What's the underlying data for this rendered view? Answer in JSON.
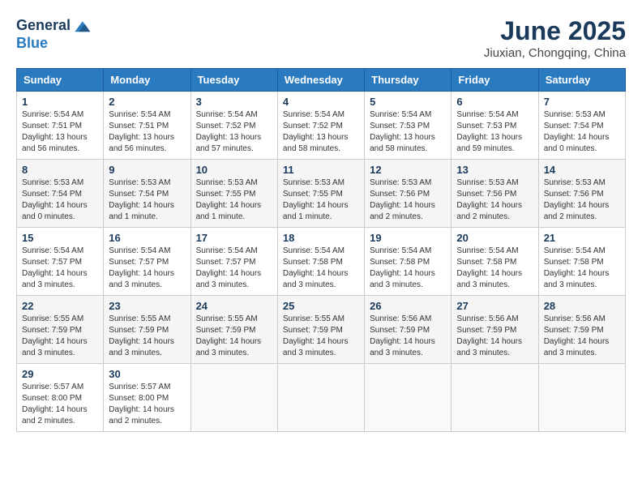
{
  "header": {
    "logo_line1": "General",
    "logo_line2": "Blue",
    "title": "June 2025",
    "subtitle": "Jiuxian, Chongqing, China"
  },
  "weekdays": [
    "Sunday",
    "Monday",
    "Tuesday",
    "Wednesday",
    "Thursday",
    "Friday",
    "Saturday"
  ],
  "weeks": [
    [
      {
        "day": "1",
        "lines": [
          "Sunrise: 5:54 AM",
          "Sunset: 7:51 PM",
          "Daylight: 13 hours",
          "and 56 minutes."
        ]
      },
      {
        "day": "2",
        "lines": [
          "Sunrise: 5:54 AM",
          "Sunset: 7:51 PM",
          "Daylight: 13 hours",
          "and 56 minutes."
        ]
      },
      {
        "day": "3",
        "lines": [
          "Sunrise: 5:54 AM",
          "Sunset: 7:52 PM",
          "Daylight: 13 hours",
          "and 57 minutes."
        ]
      },
      {
        "day": "4",
        "lines": [
          "Sunrise: 5:54 AM",
          "Sunset: 7:52 PM",
          "Daylight: 13 hours",
          "and 58 minutes."
        ]
      },
      {
        "day": "5",
        "lines": [
          "Sunrise: 5:54 AM",
          "Sunset: 7:53 PM",
          "Daylight: 13 hours",
          "and 58 minutes."
        ]
      },
      {
        "day": "6",
        "lines": [
          "Sunrise: 5:54 AM",
          "Sunset: 7:53 PM",
          "Daylight: 13 hours",
          "and 59 minutes."
        ]
      },
      {
        "day": "7",
        "lines": [
          "Sunrise: 5:53 AM",
          "Sunset: 7:54 PM",
          "Daylight: 14 hours",
          "and 0 minutes."
        ]
      }
    ],
    [
      {
        "day": "8",
        "lines": [
          "Sunrise: 5:53 AM",
          "Sunset: 7:54 PM",
          "Daylight: 14 hours",
          "and 0 minutes."
        ]
      },
      {
        "day": "9",
        "lines": [
          "Sunrise: 5:53 AM",
          "Sunset: 7:54 PM",
          "Daylight: 14 hours",
          "and 1 minute."
        ]
      },
      {
        "day": "10",
        "lines": [
          "Sunrise: 5:53 AM",
          "Sunset: 7:55 PM",
          "Daylight: 14 hours",
          "and 1 minute."
        ]
      },
      {
        "day": "11",
        "lines": [
          "Sunrise: 5:53 AM",
          "Sunset: 7:55 PM",
          "Daylight: 14 hours",
          "and 1 minute."
        ]
      },
      {
        "day": "12",
        "lines": [
          "Sunrise: 5:53 AM",
          "Sunset: 7:56 PM",
          "Daylight: 14 hours",
          "and 2 minutes."
        ]
      },
      {
        "day": "13",
        "lines": [
          "Sunrise: 5:53 AM",
          "Sunset: 7:56 PM",
          "Daylight: 14 hours",
          "and 2 minutes."
        ]
      },
      {
        "day": "14",
        "lines": [
          "Sunrise: 5:53 AM",
          "Sunset: 7:56 PM",
          "Daylight: 14 hours",
          "and 2 minutes."
        ]
      }
    ],
    [
      {
        "day": "15",
        "lines": [
          "Sunrise: 5:54 AM",
          "Sunset: 7:57 PM",
          "Daylight: 14 hours",
          "and 3 minutes."
        ]
      },
      {
        "day": "16",
        "lines": [
          "Sunrise: 5:54 AM",
          "Sunset: 7:57 PM",
          "Daylight: 14 hours",
          "and 3 minutes."
        ]
      },
      {
        "day": "17",
        "lines": [
          "Sunrise: 5:54 AM",
          "Sunset: 7:57 PM",
          "Daylight: 14 hours",
          "and 3 minutes."
        ]
      },
      {
        "day": "18",
        "lines": [
          "Sunrise: 5:54 AM",
          "Sunset: 7:58 PM",
          "Daylight: 14 hours",
          "and 3 minutes."
        ]
      },
      {
        "day": "19",
        "lines": [
          "Sunrise: 5:54 AM",
          "Sunset: 7:58 PM",
          "Daylight: 14 hours",
          "and 3 minutes."
        ]
      },
      {
        "day": "20",
        "lines": [
          "Sunrise: 5:54 AM",
          "Sunset: 7:58 PM",
          "Daylight: 14 hours",
          "and 3 minutes."
        ]
      },
      {
        "day": "21",
        "lines": [
          "Sunrise: 5:54 AM",
          "Sunset: 7:58 PM",
          "Daylight: 14 hours",
          "and 3 minutes."
        ]
      }
    ],
    [
      {
        "day": "22",
        "lines": [
          "Sunrise: 5:55 AM",
          "Sunset: 7:59 PM",
          "Daylight: 14 hours",
          "and 3 minutes."
        ]
      },
      {
        "day": "23",
        "lines": [
          "Sunrise: 5:55 AM",
          "Sunset: 7:59 PM",
          "Daylight: 14 hours",
          "and 3 minutes."
        ]
      },
      {
        "day": "24",
        "lines": [
          "Sunrise: 5:55 AM",
          "Sunset: 7:59 PM",
          "Daylight: 14 hours",
          "and 3 minutes."
        ]
      },
      {
        "day": "25",
        "lines": [
          "Sunrise: 5:55 AM",
          "Sunset: 7:59 PM",
          "Daylight: 14 hours",
          "and 3 minutes."
        ]
      },
      {
        "day": "26",
        "lines": [
          "Sunrise: 5:56 AM",
          "Sunset: 7:59 PM",
          "Daylight: 14 hours",
          "and 3 minutes."
        ]
      },
      {
        "day": "27",
        "lines": [
          "Sunrise: 5:56 AM",
          "Sunset: 7:59 PM",
          "Daylight: 14 hours",
          "and 3 minutes."
        ]
      },
      {
        "day": "28",
        "lines": [
          "Sunrise: 5:56 AM",
          "Sunset: 7:59 PM",
          "Daylight: 14 hours",
          "and 3 minutes."
        ]
      }
    ],
    [
      {
        "day": "29",
        "lines": [
          "Sunrise: 5:57 AM",
          "Sunset: 8:00 PM",
          "Daylight: 14 hours",
          "and 2 minutes."
        ]
      },
      {
        "day": "30",
        "lines": [
          "Sunrise: 5:57 AM",
          "Sunset: 8:00 PM",
          "Daylight: 14 hours",
          "and 2 minutes."
        ]
      },
      {
        "day": "",
        "lines": []
      },
      {
        "day": "",
        "lines": []
      },
      {
        "day": "",
        "lines": []
      },
      {
        "day": "",
        "lines": []
      },
      {
        "day": "",
        "lines": []
      }
    ]
  ]
}
